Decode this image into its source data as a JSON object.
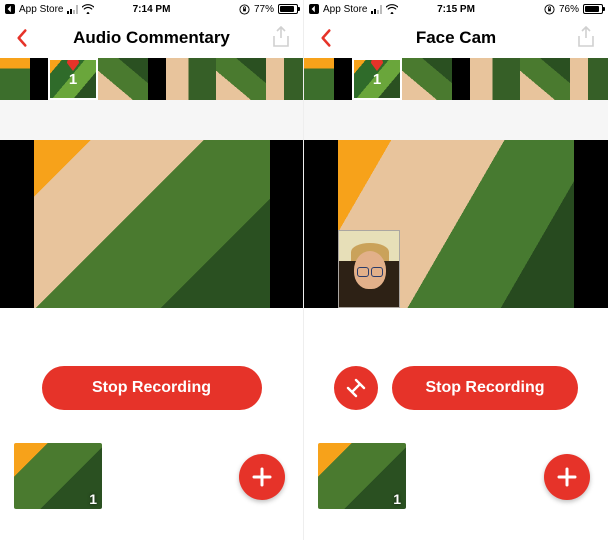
{
  "screens": [
    {
      "status": {
        "app_back": "App Store",
        "time": "7:14 PM",
        "battery_pct": "77%",
        "battery_fill": 77
      },
      "nav": {
        "title": "Audio Commentary"
      },
      "strip_marker_num": "1",
      "controls": {
        "stop_label": "Stop Recording",
        "has_swap": false
      },
      "clip_num": "1"
    },
    {
      "status": {
        "app_back": "App Store",
        "time": "7:15 PM",
        "battery_pct": "76%",
        "battery_fill": 76
      },
      "nav": {
        "title": "Face Cam"
      },
      "strip_marker_num": "1",
      "controls": {
        "stop_label": "Stop Recording",
        "has_swap": true
      },
      "clip_num": "1"
    }
  ]
}
